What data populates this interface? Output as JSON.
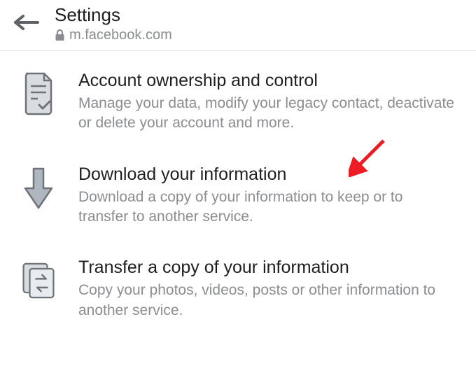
{
  "header": {
    "title": "Settings",
    "url": "m.facebook.com"
  },
  "items": [
    {
      "title": "Account ownership and control",
      "desc": "Manage your data, modify your legacy contact, deactivate or delete your account and more."
    },
    {
      "title": "Download your information",
      "desc": "Download a copy of your information to keep or to transfer to another service."
    },
    {
      "title": "Transfer a copy of your information",
      "desc": "Copy your photos, videos, posts or other information to another service."
    }
  ]
}
